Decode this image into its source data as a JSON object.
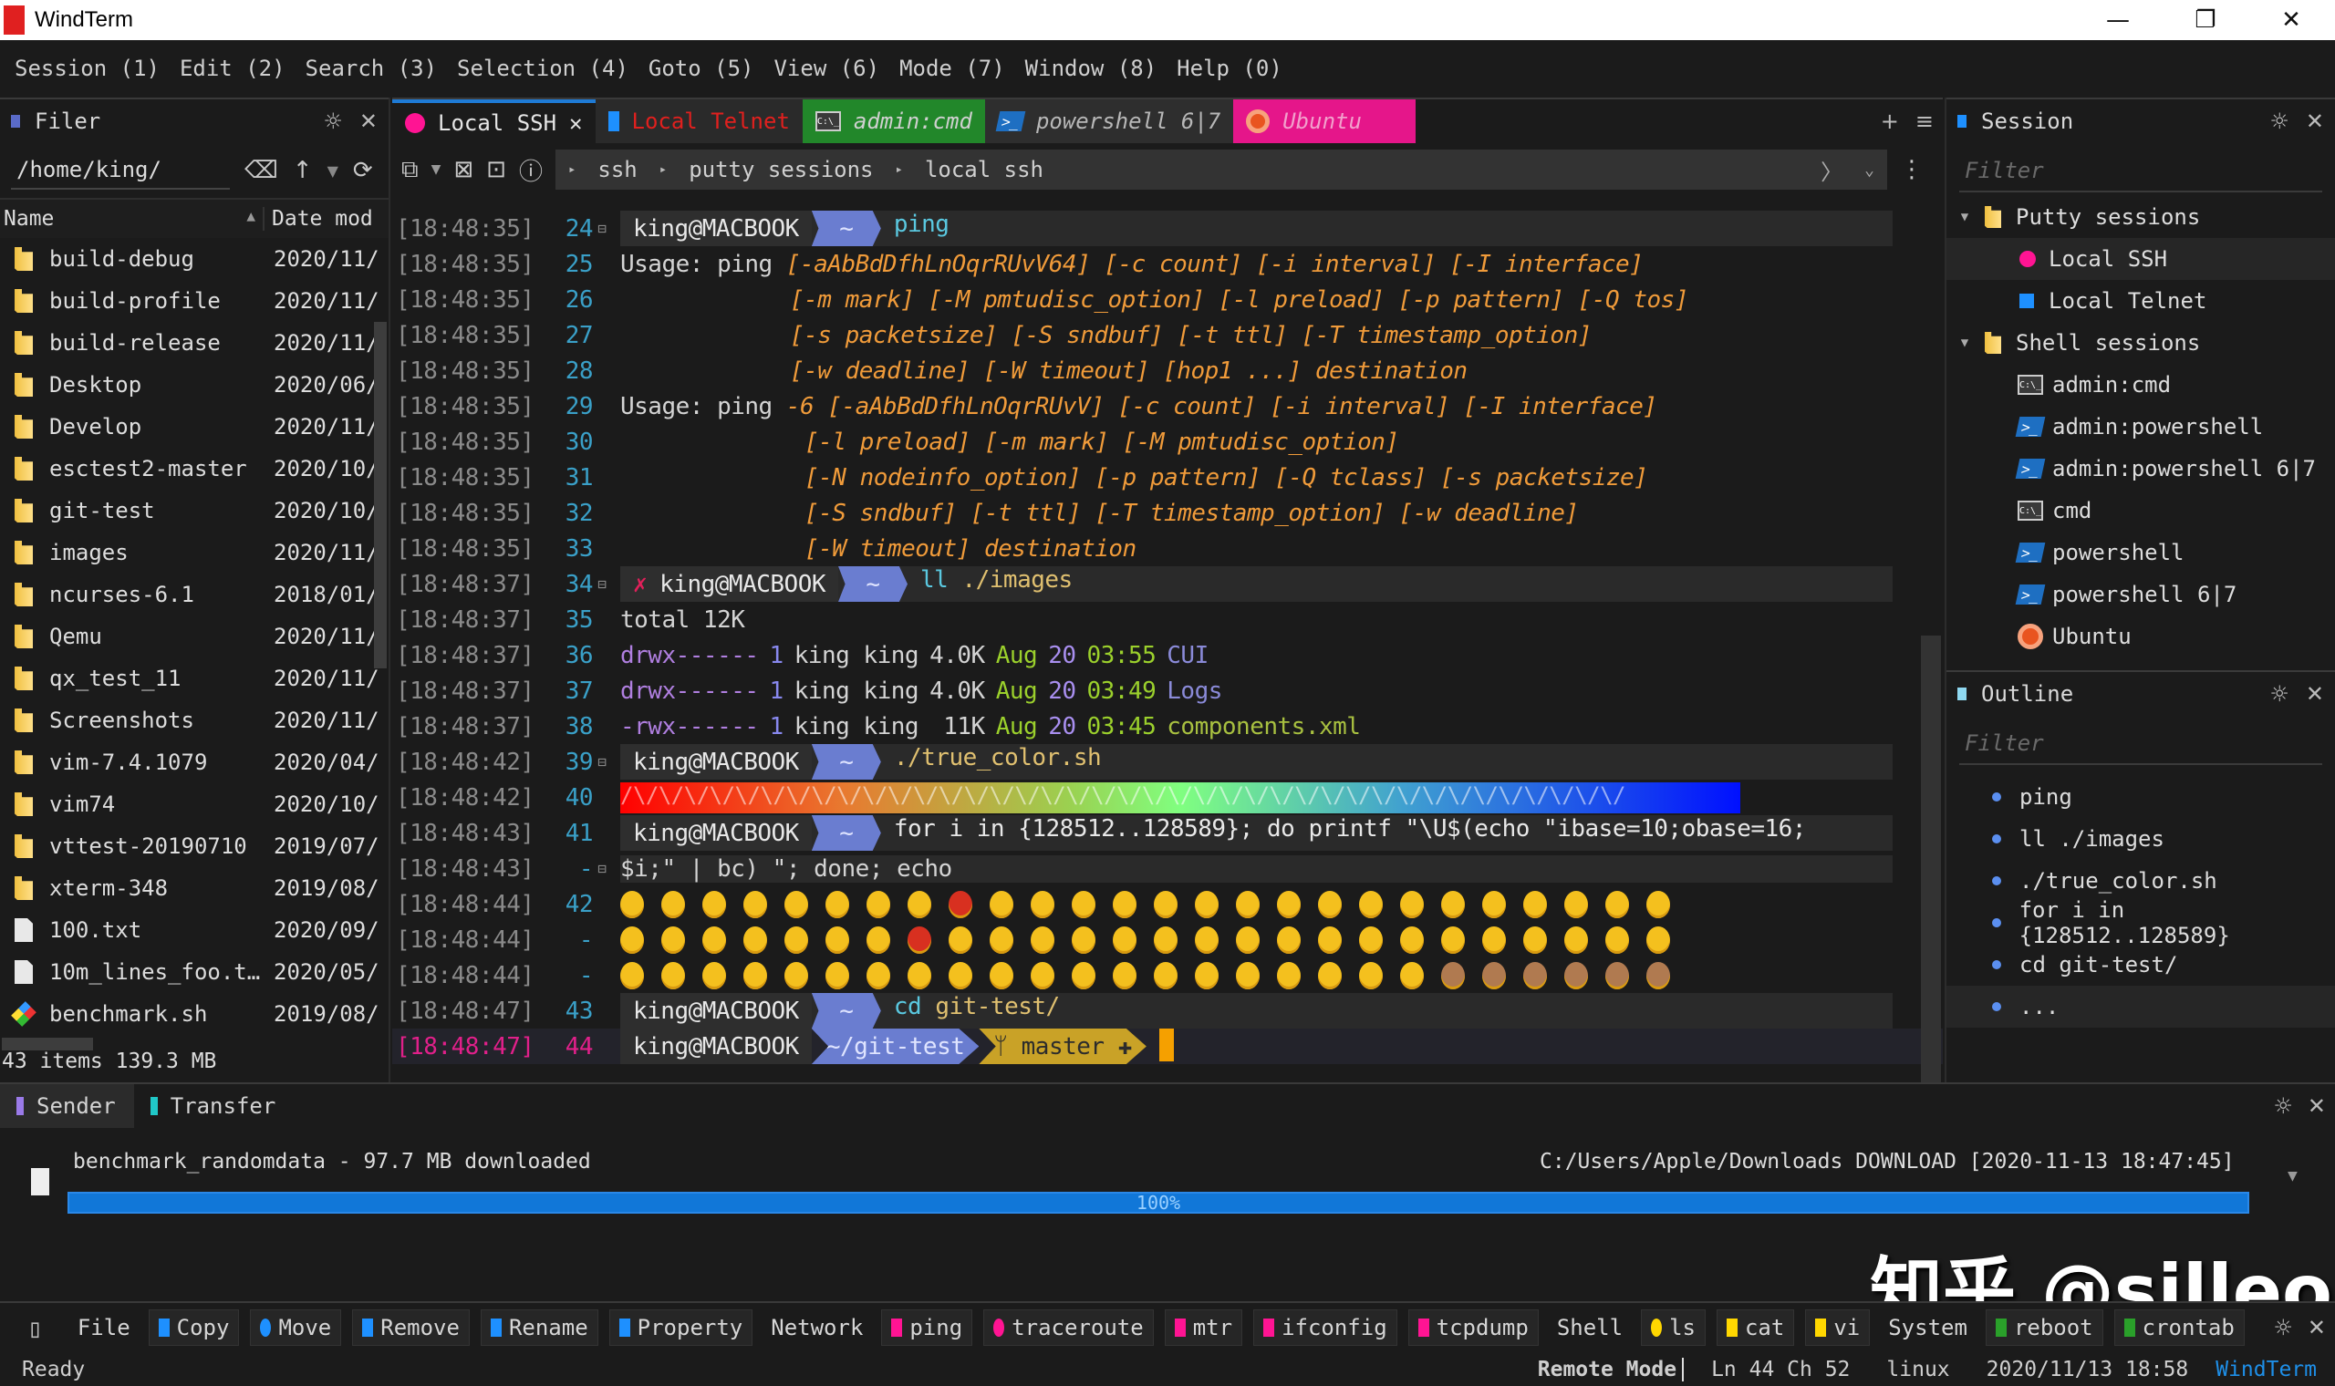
{
  "window": {
    "title": "WindTerm",
    "controls": {
      "minimize": "—",
      "restore": "❐",
      "close": "✕"
    }
  },
  "menu": [
    "Session (1)",
    "Edit (2)",
    "Search (3)",
    "Selection (4)",
    "Goto (5)",
    "View (6)",
    "Mode (7)",
    "Window (8)",
    "Help (0)"
  ],
  "filer": {
    "title": "Filer",
    "path": "/home/king/",
    "columns": {
      "name": "Name",
      "date": "Date mod"
    },
    "items": [
      {
        "name": "build-debug",
        "date": "2020/11/",
        "type": "folder"
      },
      {
        "name": "build-profile",
        "date": "2020/11/",
        "type": "folder"
      },
      {
        "name": "build-release",
        "date": "2020/11/",
        "type": "folder"
      },
      {
        "name": "Desktop",
        "date": "2020/06/",
        "type": "folder"
      },
      {
        "name": "Develop",
        "date": "2020/11/",
        "type": "folder"
      },
      {
        "name": "esctest2-master",
        "date": "2020/10/",
        "type": "folder"
      },
      {
        "name": "git-test",
        "date": "2020/10/",
        "type": "folder"
      },
      {
        "name": "images",
        "date": "2020/11/",
        "type": "folder"
      },
      {
        "name": "ncurses-6.1",
        "date": "2018/01/",
        "type": "folder"
      },
      {
        "name": "Qemu",
        "date": "2020/11/",
        "type": "folder"
      },
      {
        "name": "qx_test_11",
        "date": "2020/11/",
        "type": "folder"
      },
      {
        "name": "Screenshots",
        "date": "2020/11/",
        "type": "folder"
      },
      {
        "name": "vim-7.4.1079",
        "date": "2020/04/",
        "type": "folder"
      },
      {
        "name": "vim74",
        "date": "2020/10/",
        "type": "folder"
      },
      {
        "name": "vttest-20190710",
        "date": "2019/07/",
        "type": "folder"
      },
      {
        "name": "xterm-348",
        "date": "2019/08/",
        "type": "folder"
      },
      {
        "name": "100.txt",
        "date": "2020/09/",
        "type": "file"
      },
      {
        "name": "10m_lines_foo.t…",
        "date": "2020/05/",
        "type": "file"
      },
      {
        "name": "benchmark.sh",
        "date": "2019/08/",
        "type": "script"
      }
    ],
    "summary": "43 items 139.3 MB"
  },
  "tabs": [
    {
      "label": "Local SSH",
      "color": "#ff1493",
      "active": true
    },
    {
      "label": "Local Telnet",
      "color": "#1e90ff"
    },
    {
      "label": "admin:cmd"
    },
    {
      "label": "powershell 6|7"
    },
    {
      "label": "Ubuntu"
    }
  ],
  "breadcrumb": [
    "ssh",
    "putty sessions",
    "local ssh"
  ],
  "terminal": {
    "user": "king@MACBOOK",
    "lines": [
      {
        "ts": "[18:48:35]",
        "ln": "24"
      },
      {
        "ts": "[18:48:35]",
        "ln": "25"
      },
      {
        "ts": "[18:48:35]",
        "ln": "26"
      },
      {
        "ts": "[18:48:35]",
        "ln": "27"
      },
      {
        "ts": "[18:48:35]",
        "ln": "28"
      },
      {
        "ts": "[18:48:35]",
        "ln": "29"
      },
      {
        "ts": "[18:48:35]",
        "ln": "30"
      },
      {
        "ts": "[18:48:35]",
        "ln": "31"
      },
      {
        "ts": "[18:48:35]",
        "ln": "32"
      },
      {
        "ts": "[18:48:35]",
        "ln": "33"
      },
      {
        "ts": "[18:48:37]",
        "ln": "34"
      },
      {
        "ts": "[18:48:37]",
        "ln": "35"
      },
      {
        "ts": "[18:48:37]",
        "ln": "36"
      },
      {
        "ts": "[18:48:37]",
        "ln": "37"
      },
      {
        "ts": "[18:48:37]",
        "ln": "38"
      },
      {
        "ts": "[18:48:42]",
        "ln": "39"
      },
      {
        "ts": "[18:48:42]",
        "ln": "40"
      },
      {
        "ts": "[18:48:43]",
        "ln": "41"
      },
      {
        "ts": "[18:48:43]",
        "ln": "-"
      },
      {
        "ts": "[18:48:44]",
        "ln": "42"
      },
      {
        "ts": "[18:48:44]",
        "ln": "-"
      },
      {
        "ts": "[18:48:44]",
        "ln": "-"
      },
      {
        "ts": "[18:48:47]",
        "ln": "43"
      },
      {
        "ts": "[18:48:47]",
        "ln": "44"
      }
    ],
    "cmd_ping": "ping",
    "usage": "Usage: ping",
    "cmd_ll": "ll",
    "arg_ll": "./images",
    "total": "total 12K",
    "ls_rows": [
      {
        "perm": "drwx------",
        "n": "1",
        "u": "king king",
        "size": "4.0K",
        "mon": "Aug",
        "day": "20",
        "time": "03:55",
        "name": "CUI"
      },
      {
        "perm": "drwx------",
        "n": "1",
        "u": "king king",
        "size": "4.0K",
        "mon": "Aug",
        "day": "20",
        "time": "03:49",
        "name": "Logs"
      },
      {
        "perm": "-rwx------",
        "n": "1",
        "u": "king king",
        "size": " 11K",
        "mon": "Aug",
        "day": "20",
        "time": "03:45",
        "name": "components.xml"
      }
    ],
    "cmd_truecolor": "./true_color.sh",
    "rainbow_text": "/\\/\\/\\/\\/\\/\\/\\/\\/\\/\\/\\/\\/\\/\\/\\/\\/\\/\\/\\/\\/\\/\\/\\/\\/\\/\\/\\/\\/\\/\\/\\/\\/\\/\\/\\/\\/\\/\\/\\/",
    "for_cmd": "for i in {128512..128589}; do printf \"\\U$(echo \"ibase=10;obase=16;",
    "for_cont": "$i;\" | bc) \"; done; echo",
    "cmd_cd": "cd",
    "arg_cd": "git-test/",
    "cwd_home": "~",
    "cwd_git": "~/git-test",
    "git_branch": "master",
    "ping_lines": [
      "[-aAbBdDfhLnOqrRUvV64] [-c count] [-i interval] [-I interface]",
      "[-m mark] [-M pmtudisc_option] [-l preload] [-p pattern] [-Q tos]",
      "[-s packetsize] [-S sndbuf] [-t ttl] [-T timestamp_option]",
      "[-w deadline] [-W timeout] [hop1 ...] destination",
      "-6 [-aAbBdDfhLnOqrRUvV] [-c count] [-i interval] [-I interface]",
      "[-l preload] [-m mark] [-M pmtudisc_option]",
      "[-N nodeinfo_option] [-p pattern] [-Q tclass] [-s packetsize]",
      "[-S sndbuf] [-t ttl] [-T timestamp_option] [-w deadline]",
      "[-W timeout] destination"
    ]
  },
  "session_panel": {
    "title": "Session",
    "filter_placeholder": "Filter",
    "groups": [
      {
        "label": "Putty sessions",
        "items": [
          {
            "label": "Local SSH",
            "icon": "pink-dot"
          },
          {
            "label": "Local Telnet",
            "icon": "blue-square"
          }
        ]
      },
      {
        "label": "Shell sessions",
        "items": [
          {
            "label": "admin:cmd",
            "icon": "cmd"
          },
          {
            "label": "admin:powershell",
            "icon": "powershell"
          },
          {
            "label": "admin:powershell 6|7",
            "icon": "powershell"
          },
          {
            "label": "cmd",
            "icon": "cmd"
          },
          {
            "label": "powershell",
            "icon": "powershell"
          },
          {
            "label": "powershell 6|7",
            "icon": "powershell"
          },
          {
            "label": "Ubuntu",
            "icon": "ubuntu"
          }
        ]
      }
    ]
  },
  "outline_panel": {
    "title": "Outline",
    "filter_placeholder": "Filter",
    "items": [
      "ping",
      "ll ./images",
      "./true_color.sh",
      "for i in {128512..128589}",
      "cd git-test/",
      "..."
    ]
  },
  "transfer": {
    "tabs": [
      "Sender",
      "Transfer"
    ],
    "file": "benchmark_randomdata - 97.7 MB downloaded",
    "dest": "C:/Users/Apple/Downloads DOWNLOAD [2020-11-13 18:47:45]",
    "progress_label": "100%",
    "progress": 1.0
  },
  "quickbar": {
    "groups": [
      {
        "label": "File",
        "buttons": [
          {
            "label": "Copy",
            "color": "#1e90ff"
          },
          {
            "label": "Move",
            "color": "#1e90ff"
          },
          {
            "label": "Remove",
            "color": "#1e90ff"
          },
          {
            "label": "Rename",
            "color": "#1e90ff"
          },
          {
            "label": "Property",
            "color": "#1e90ff"
          }
        ]
      },
      {
        "label": "Network",
        "buttons": [
          {
            "label": "ping",
            "color": "#ff1493"
          },
          {
            "label": "traceroute",
            "color": "#ff1493"
          },
          {
            "label": "mtr",
            "color": "#ff1493"
          },
          {
            "label": "ifconfig",
            "color": "#ff1493"
          },
          {
            "label": "tcpdump",
            "color": "#ff1493"
          }
        ]
      },
      {
        "label": "Shell",
        "buttons": [
          {
            "label": "ls",
            "color": "#ffd700"
          },
          {
            "label": "cat",
            "color": "#ffd700"
          },
          {
            "label": "vi",
            "color": "#ffd700"
          }
        ]
      },
      {
        "label": "System",
        "buttons": [
          {
            "label": "reboot",
            "color": "#2aa02a"
          },
          {
            "label": "crontab",
            "color": "#2aa02a"
          }
        ]
      }
    ]
  },
  "status": {
    "left": "Ready",
    "mode": "Remote Mode",
    "position": "Ln 44 Ch 52",
    "os": "linux",
    "datetime": "2020/11/13 18:58",
    "app": "WindTerm"
  },
  "watermark": "知乎 @sjlleo"
}
